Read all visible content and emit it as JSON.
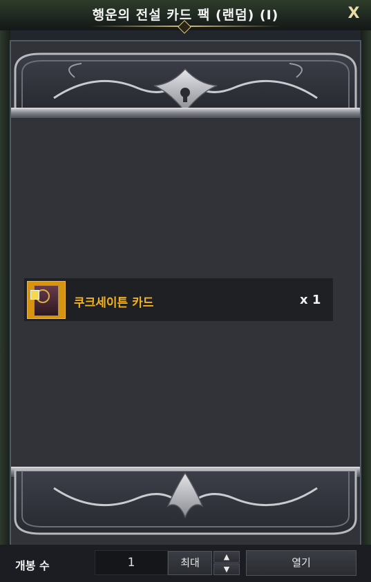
{
  "window": {
    "title": "행운의 전설 카드 팩 (랜덤) (I)",
    "close_label": "X"
  },
  "rewards": [
    {
      "name": "쿠크세이튼 카드",
      "quantity_label": "x 1",
      "icon": "card-pack-icon",
      "name_color": "#f4b21c",
      "icon_bg_color": "#d8940e"
    }
  ],
  "open_controls": {
    "open_count_label": "개봉 수",
    "open_count_value": "1",
    "max_label": "최대",
    "up_icon": "chevron-up-icon",
    "down_icon": "chevron-down-icon",
    "open_label": "열기"
  },
  "colors": {
    "panel_bg": "#313338",
    "frame_border": "#4b5c66",
    "title_text": "#f4f4f4",
    "close_text": "#e8dca8"
  }
}
